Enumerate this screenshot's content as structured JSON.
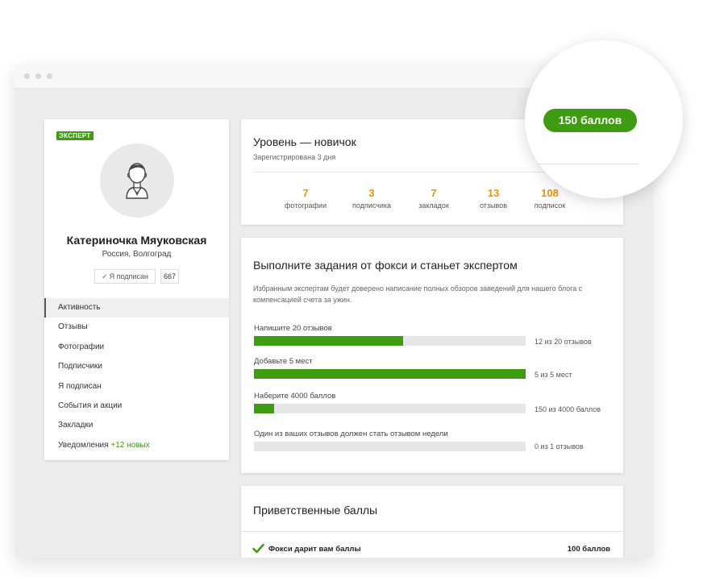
{
  "profile": {
    "badge": "ЭКСПЕРТ",
    "name": "Катериночка Мяуковская",
    "location": "Россия, Волгоград",
    "subscribe_label": "Я подписан",
    "subscribe_check": "✓",
    "subscribers_count": "667"
  },
  "nav": {
    "items": [
      {
        "label": "Активность"
      },
      {
        "label": "Отзывы"
      },
      {
        "label": "Фотографии"
      },
      {
        "label": "Подписчики"
      },
      {
        "label": "Я подписан"
      },
      {
        "label": "События и акции"
      },
      {
        "label": "Закладки"
      },
      {
        "label": "Уведомления",
        "extra": "+12 новых"
      }
    ]
  },
  "level": {
    "title": "Уровень — новичок",
    "subtitle": "Зарегистрирована 3 дня",
    "points": "150 баллов",
    "stats": [
      {
        "value": "7",
        "label": "фотографии"
      },
      {
        "value": "3",
        "label": "подписчика"
      },
      {
        "value": "7",
        "label": "закладок"
      },
      {
        "value": "13",
        "label": "отзывов"
      },
      {
        "value": "108",
        "label": "подписок"
      }
    ]
  },
  "tasks": {
    "title": "Выполните задания от фокси и станьет экспертом",
    "description": "Избранным экспертам будет доверено написание полных обзоров заведений для нашего блога с компенсацией счета за ужин.",
    "items": [
      {
        "label": "Напишите 20 отзывов",
        "progress": 0.55,
        "progress_text": "12 из 20 отзывов"
      },
      {
        "label": "Добавьте 5 мест",
        "progress": 1.0,
        "progress_text": "5 из 5 мест"
      },
      {
        "label": "Наберите 4000 баллов",
        "progress": 0.075,
        "progress_text": "150 из 4000 баллов"
      },
      {
        "label": "Один из ваших отзывов должен стать отзывом недели",
        "progress": 0.0,
        "progress_text": "0 из 1 отзывов"
      }
    ]
  },
  "welcome": {
    "title": "Приветственные баллы",
    "items": [
      {
        "label": "Фокси дарит вам баллы",
        "points": "100 баллов"
      }
    ]
  },
  "colors": {
    "accent_green": "#3e9b12",
    "stat_orange": "#f39200"
  },
  "icons": {
    "avatar": "user-avatar-icon",
    "check": "checkmark-icon"
  }
}
